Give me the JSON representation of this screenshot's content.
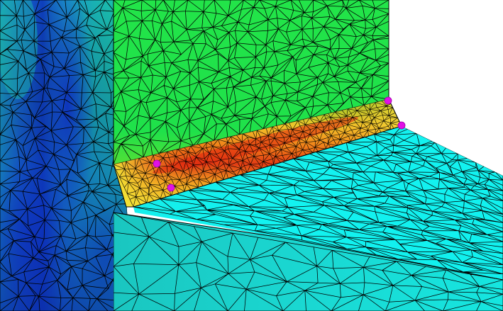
{
  "view": {
    "kind": "finite-element stress contour plot (welded T-joint)",
    "background_color": "#ffffff",
    "mesh_line_color": "#000000"
  },
  "colors": {
    "vertical_plate": "#1fe14a",
    "horizontal_plate": "#14f0ee",
    "plate_end_face": "#1ad8cf",
    "weld_hot": "#e63a14",
    "weld_warm": "#ff7a10",
    "weld_edge": "#f2f23c",
    "left_block_base": "#18b8a8",
    "left_block_deep": "#0d33bb",
    "left_block_mid": "#1579cf",
    "markers": "#e012e6"
  },
  "markers": {
    "count": 4,
    "shape": "dot-icon"
  }
}
